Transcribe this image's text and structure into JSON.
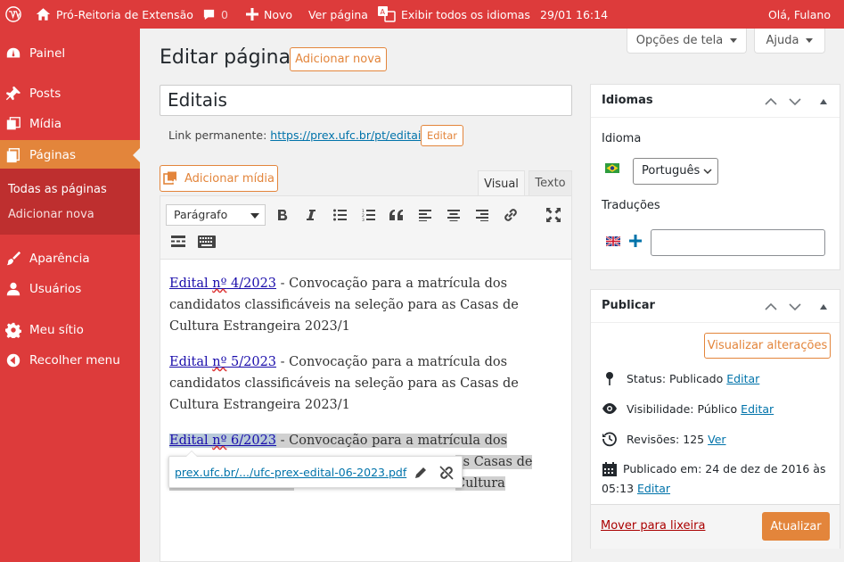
{
  "adminbar": {
    "wp_logo": "wordpress-icon",
    "site_name": "Pró-Reitoria de Extensão",
    "comments_count": "0",
    "new_label": "Novo",
    "view_page": "Ver página",
    "languages": "Exibir todos os idiomas",
    "date": "29/01 16:14",
    "greeting": "Olá, Fulano"
  },
  "sidemenu": {
    "items": [
      {
        "label": "Painel",
        "icon": "dashboard-icon"
      },
      {
        "label": "Posts",
        "icon": "pin-icon"
      },
      {
        "label": "Mídia",
        "icon": "media-icon"
      },
      {
        "label": "Páginas",
        "icon": "pages-icon"
      },
      {
        "label": "Aparência",
        "icon": "brush-icon"
      },
      {
        "label": "Usuários",
        "icon": "users-icon"
      },
      {
        "label": "Meu sítio",
        "icon": "gear-icon"
      },
      {
        "label": "Recolher menu",
        "icon": "collapse-icon"
      }
    ],
    "submenu": [
      "Todas as páginas",
      "Adicionar nova"
    ]
  },
  "screen": {
    "options": "Opções de tela",
    "help": "Ajuda"
  },
  "header": {
    "title": "Editar página",
    "add_new": "Adicionar nova"
  },
  "post": {
    "title": "Editais",
    "permalink_label": "Link permanente:",
    "permalink_url": "https://prex.ufc.br/pt/editais/",
    "edit_button": "Editar"
  },
  "editor": {
    "add_media": "Adicionar mídia",
    "tab_visual": "Visual",
    "tab_text": "Texto",
    "format": "Parágrafo",
    "paragraphs": [
      {
        "link_a": "Edital ",
        "link_b": "nº",
        "link_c": " 4/2023",
        "text": " - Convocação para a matrícula dos candidatos classificáveis na seleção para as Casas de Cultura Estrangeira 2023/1"
      },
      {
        "link_a": "Edital ",
        "link_b": "nº",
        "link_c": " 5/2023",
        "text": " - Convocação para a matrícula dos candidatos classificáveis na seleção para as Casas de Cultura Estrangeira 2023/1"
      },
      {
        "link_a": "Edital ",
        "link_b": "nº",
        "link_c": " 6/2023",
        "text": " - Convocação para a matrícula dos",
        "text2": "as Casas de Cultura"
      }
    ],
    "link_popup_url": "prex.ufc.br/.../ufc-prex-edital-06-2023.pdf"
  },
  "idiomas": {
    "title": "Idiomas",
    "language_label": "Idioma",
    "language_value": "Português",
    "translations_label": "Traduções",
    "translation_value": ""
  },
  "publicar": {
    "title": "Publicar",
    "preview": "Visualizar alterações",
    "status_label": "Status:",
    "status_value": "Publicado",
    "visibility_label": "Visibilidade:",
    "visibility_value": "Público",
    "revisions_label": "Revisões:",
    "revisions_value": "125",
    "revisions_link": "Ver",
    "published_line1": "Publicado em: 24 de dez de 2016 às",
    "published_line2": "05:13",
    "edit": "Editar",
    "trash": "Mover para lixeira",
    "update": "Atualizar"
  },
  "colors": {
    "adminbar": "#dd3b3b",
    "accent": "#e3853b",
    "link": "#0073aa"
  }
}
